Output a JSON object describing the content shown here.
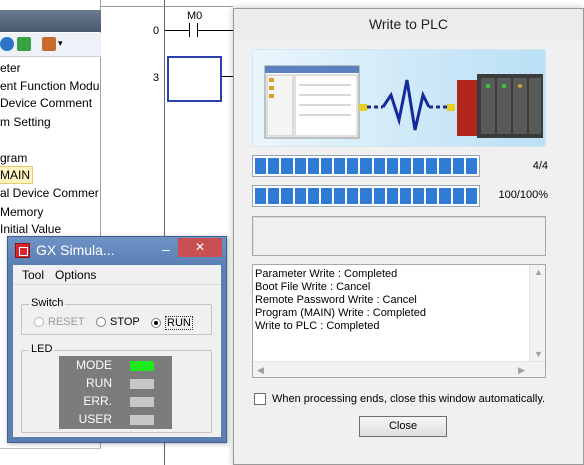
{
  "project_tree": {
    "items": [
      {
        "label": "eter",
        "selected": false
      },
      {
        "label": "ent Function Modu",
        "selected": false
      },
      {
        "label": "Device Comment",
        "selected": false
      },
      {
        "label": "m Setting",
        "selected": false
      },
      {
        "label": "gram",
        "selected": false
      },
      {
        "label": "MAIN",
        "selected": true
      },
      {
        "label": "al Device Commer",
        "selected": false
      },
      {
        "label": "Memory",
        "selected": false
      },
      {
        "label": "Initial Value",
        "selected": false
      }
    ]
  },
  "ladder": {
    "contact_label": "M0",
    "steps": [
      "0",
      "3"
    ]
  },
  "write_dialog": {
    "title": "Write to PLC",
    "progress_1": {
      "text": "4/4",
      "fraction": 1.0
    },
    "progress_2": {
      "text": "100/100%",
      "fraction": 1.0
    },
    "log_lines": [
      "Parameter Write : Completed",
      "Boot File Write : Cancel",
      "Remote Password Write : Cancel",
      "Program (MAIN) Write : Completed",
      "Write to PLC : Completed"
    ],
    "auto_close_label": "When processing ends, close this window automatically.",
    "auto_close_checked": false,
    "close_button": "Close"
  },
  "simulator": {
    "title": "GX Simula...",
    "close_glyph": "✕",
    "minimize_glyph": "–",
    "menu": [
      "Tool",
      "Options"
    ],
    "switch_group": "Switch",
    "switch_options": [
      {
        "label": "RESET",
        "selected": false,
        "enabled": false
      },
      {
        "label": "STOP",
        "selected": false,
        "enabled": true
      },
      {
        "label": "RUN",
        "selected": true,
        "enabled": true
      }
    ],
    "led_group": "LED",
    "leds": [
      {
        "label": "MODE",
        "on": true
      },
      {
        "label": "RUN",
        "on": false
      },
      {
        "label": "ERR.",
        "on": false
      },
      {
        "label": "USER",
        "on": false
      }
    ],
    "led_on_color": "#1ee81e",
    "led_off_color": "#c8c8c8"
  }
}
